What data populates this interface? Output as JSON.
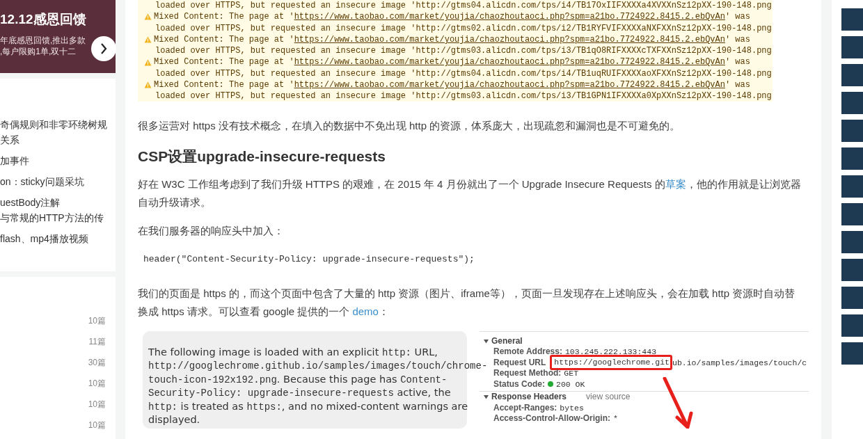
{
  "promo": {
    "title": "12.12感恩回馈",
    "lines": [
      "年底感恩回馈,推出多款",
      ",每户限购1单,双十二"
    ]
  },
  "article_list": [
    {
      "lines": [
        "奇偶规则和非零环绕树规",
        "关系"
      ]
    },
    {
      "lines": [
        "加事件"
      ]
    },
    {
      "lines": [
        "on：sticky问题采坑"
      ]
    },
    {
      "lines": [
        "uestBody注解",
        "与常规的HTTP方法的传"
      ]
    },
    {
      "lines": [
        "flash、mp4播放视频"
      ]
    }
  ],
  "category_counts": [
    "10篇",
    "11篇",
    "30篇",
    "10篇",
    "10篇",
    "10篇"
  ],
  "console_lines": [
    {
      "kind": "continuation",
      "text": "loaded over HTTPS, but requested an insecure image 'http://gtms04.alicdn.com/tps/i4/TB17OxIIFXXXXa4XVXXnSz12pXX-190-148.png"
    },
    {
      "kind": "warning",
      "prefix": "Mixed Content: The page at '",
      "url": "https://www.taobao.com/market/youjia/chaozhoutaoci.php?spm=a21bo.7724922.8415.2.ebQvAn",
      "suffix": "' was"
    },
    {
      "kind": "continuation",
      "text": "loaded over HTTPS, but requested an insecure image 'http://gtms02.alicdn.com/tps/i2/TB1RYFVIFXXXXaNXFXXnSz12pXX-190-148.png"
    },
    {
      "kind": "warning",
      "prefix": "Mixed Content: The page at '",
      "url": "https://www.taobao.com/market/youjia/chaozhoutaoci.php?spm=a21bo.7724922.8415.2.ebQvAn",
      "suffix": "' was"
    },
    {
      "kind": "continuation",
      "text": "loaded over HTTPS, but requested an insecure image 'http://gtms03.alicdn.com/tps/i3/TB1qO8RIFXXXXcTXFXXnSz12pXX-190-148.png"
    },
    {
      "kind": "warning",
      "prefix": "Mixed Content: The page at '",
      "url": "https://www.taobao.com/market/youjia/chaozhoutaoci.php?spm=a21bo.7724922.8415.2.ebQvAn",
      "suffix": "' was"
    },
    {
      "kind": "continuation",
      "text": "loaded over HTTPS, but requested an insecure image 'http://gtms04.alicdn.com/tps/i4/TB1uqRUIFXXXXaoXFXXnSz12pXX-190-148.png"
    },
    {
      "kind": "warning",
      "prefix": "Mixed Content: The page at '",
      "url": "https://www.taobao.com/market/youjia/chaozhoutaoci.php?spm=a21bo.7724922.8415.2.ebQvAn",
      "suffix": "' was"
    },
    {
      "kind": "continuation",
      "text": "loaded over HTTPS, but requested an insecure image 'http://gtms03.alicdn.com/tps/i3/TB1GPN1IFXXXXa0XpXXnSz12pXX-190-148.png"
    }
  ],
  "blocks": [
    {
      "kind": "paragraph",
      "parts": [
        {
          "kind": "text",
          "text": "很多运营对 https 没有技术概念，在填入的数据中不免出现 http 的资源，体系庞大，出现疏忽和漏洞也是不可避免的。"
        }
      ]
    },
    {
      "kind": "heading",
      "text": "CSP设置upgrade-insecure-requests"
    },
    {
      "kind": "paragraph",
      "parts": [
        {
          "kind": "text",
          "text": "好在 W3C 工作组考虑到了我们升级 HTTPS 的艰难，在 2015 年 4 月份就出了一个 Upgrade Insecure Requests 的"
        },
        {
          "kind": "link",
          "text": "草案"
        },
        {
          "kind": "text",
          "text": "，他的作用就是让浏览器自动升级请求。"
        }
      ]
    },
    {
      "kind": "paragraph",
      "parts": [
        {
          "kind": "text",
          "text": "在我们服务器的响应头中加入："
        }
      ]
    },
    {
      "kind": "code",
      "text": "header(\"Content-Security-Policy: upgrade-insecure-requests\");"
    },
    {
      "kind": "paragraph",
      "parts": [
        {
          "kind": "text",
          "text": "我们的页面是 https 的，而这个页面中包含了大量的 http 资源（图片、iframe等），页面一旦发现存在上述响应头，会在加载 http 资源时自动替换成 https 请求。可以查看 google 提供的一个 "
        },
        {
          "kind": "link",
          "text": "demo"
        },
        {
          "kind": "text",
          "text": "："
        }
      ]
    }
  ],
  "screenshot": {
    "note_lines": [
      [
        {
          "kind": "text",
          "text": "The following image is loaded with an explicit "
        },
        {
          "kind": "code",
          "text": "http:"
        },
        {
          "kind": "text",
          "text": " URL,"
        }
      ],
      [
        {
          "kind": "code",
          "text": "http://googlechrome.github.io/samples/images/touch/chrome-"
        }
      ],
      [
        {
          "kind": "code",
          "text": "touch-icon-192x192.png"
        },
        {
          "kind": "text",
          "text": ". Because this page has "
        },
        {
          "kind": "code",
          "text": "Content-"
        }
      ],
      [
        {
          "kind": "code",
          "text": "Security-Policy: upgrade-insecure-requests"
        },
        {
          "kind": "text",
          "text": " active, the"
        }
      ],
      [
        {
          "kind": "code",
          "text": "http:"
        },
        {
          "kind": "text",
          "text": " is treated as "
        },
        {
          "kind": "code",
          "text": "https:"
        },
        {
          "kind": "text",
          "text": ", and no mixed-content warnings are"
        }
      ],
      [
        {
          "kind": "text",
          "text": "displayed."
        }
      ]
    ],
    "sections": [
      {
        "title": "General",
        "expanded": true,
        "rows": [
          {
            "label": "Remote Address:",
            "value": "103.245.222.133:443"
          },
          {
            "label": "Request URL",
            "highlight": "https://googlechrome.git",
            "value": "ub.io/samples/images/touch/c"
          },
          {
            "label": "Request Method:",
            "value": "GET"
          },
          {
            "label": "Status Code:",
            "value": "200 OK",
            "color": "#22aa33"
          }
        ]
      },
      {
        "title": "Response Headers",
        "expanded": true,
        "link": "view source",
        "rows": [
          {
            "label": "Accept-Ranges:",
            "value": "bytes"
          },
          {
            "label": "Access-Control-Allow-Origin:",
            "value": "*"
          }
        ]
      }
    ]
  }
}
